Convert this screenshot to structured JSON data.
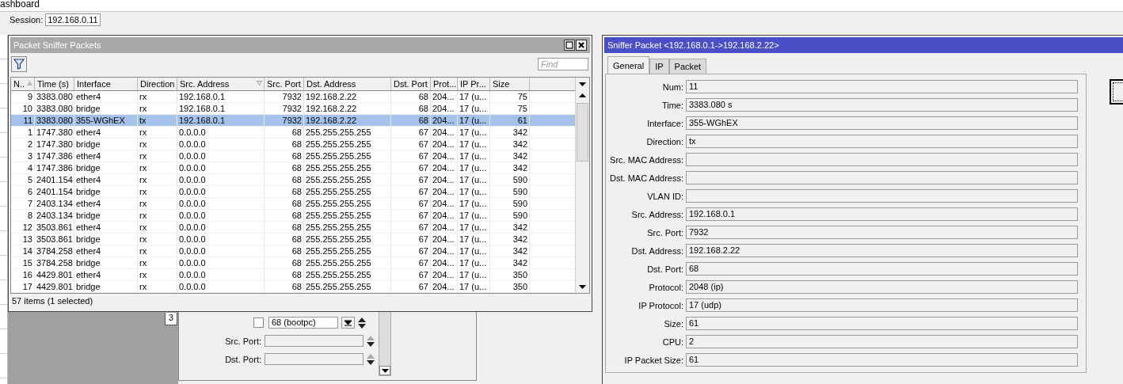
{
  "app_title": "ashboard",
  "session": {
    "label": "Session:",
    "value": "192.168.0.11"
  },
  "packets_window": {
    "title": "Packet Sniffer Packets",
    "find_placeholder": "Find",
    "columns": [
      {
        "label": "N..",
        "sort_asc": true,
        "sort_desc": false
      },
      {
        "label": "Time (s)",
        "sort_asc": false,
        "sort_desc": false
      },
      {
        "label": "Interface",
        "sort_asc": false,
        "sort_desc": false
      },
      {
        "label": "Direction",
        "sort_asc": false,
        "sort_desc": false
      },
      {
        "label": "Src. Address",
        "sort_asc": false,
        "sort_desc": true
      },
      {
        "label": "Src. Port",
        "sort_asc": false,
        "sort_desc": false
      },
      {
        "label": "Dst. Address",
        "sort_asc": false,
        "sort_desc": false
      },
      {
        "label": "Dst. Port",
        "sort_asc": false,
        "sort_desc": false
      },
      {
        "label": "Prot...",
        "sort_asc": false,
        "sort_desc": false
      },
      {
        "label": "IP Pr...",
        "sort_asc": false,
        "sort_desc": false
      },
      {
        "label": "Size",
        "sort_asc": false,
        "sort_desc": false
      }
    ],
    "rows": [
      {
        "selected": false,
        "cells": [
          "9",
          "3383.080",
          "ether4",
          "rx",
          "192.168.0.1",
          "7932",
          "192.168.2.22",
          "68",
          "204...",
          "17 (u...",
          "75"
        ]
      },
      {
        "selected": false,
        "cells": [
          "10",
          "3383.080",
          "bridge",
          "rx",
          "192.168.0.1",
          "7932",
          "192.168.2.22",
          "68",
          "204...",
          "17 (u...",
          "75"
        ]
      },
      {
        "selected": true,
        "cells": [
          "11",
          "3383.080",
          "355-WGhEX",
          "tx",
          "192.168.0.1",
          "7932",
          "192.168.2.22",
          "68",
          "204...",
          "17 (u...",
          "61"
        ]
      },
      {
        "selected": false,
        "cells": [
          "1",
          "1747.380",
          "ether4",
          "rx",
          "0.0.0.0",
          "68",
          "255.255.255.255",
          "67",
          "204...",
          "17 (u...",
          "342"
        ]
      },
      {
        "selected": false,
        "cells": [
          "2",
          "1747.380",
          "bridge",
          "rx",
          "0.0.0.0",
          "68",
          "255.255.255.255",
          "67",
          "204...",
          "17 (u...",
          "342"
        ]
      },
      {
        "selected": false,
        "cells": [
          "3",
          "1747.386",
          "ether4",
          "rx",
          "0.0.0.0",
          "68",
          "255.255.255.255",
          "67",
          "204...",
          "17 (u...",
          "342"
        ]
      },
      {
        "selected": false,
        "cells": [
          "4",
          "1747.386",
          "bridge",
          "rx",
          "0.0.0.0",
          "68",
          "255.255.255.255",
          "67",
          "204...",
          "17 (u...",
          "342"
        ]
      },
      {
        "selected": false,
        "cells": [
          "5",
          "2401.154",
          "ether4",
          "rx",
          "0.0.0.0",
          "68",
          "255.255.255.255",
          "67",
          "204...",
          "17 (u...",
          "590"
        ]
      },
      {
        "selected": false,
        "cells": [
          "6",
          "2401.154",
          "bridge",
          "rx",
          "0.0.0.0",
          "68",
          "255.255.255.255",
          "67",
          "204...",
          "17 (u...",
          "590"
        ]
      },
      {
        "selected": false,
        "cells": [
          "7",
          "2403.134",
          "ether4",
          "rx",
          "0.0.0.0",
          "68",
          "255.255.255.255",
          "67",
          "204...",
          "17 (u...",
          "590"
        ]
      },
      {
        "selected": false,
        "cells": [
          "8",
          "2403.134",
          "bridge",
          "rx",
          "0.0.0.0",
          "68",
          "255.255.255.255",
          "67",
          "204...",
          "17 (u...",
          "590"
        ]
      },
      {
        "selected": false,
        "cells": [
          "12",
          "3503.861",
          "ether4",
          "rx",
          "0.0.0.0",
          "68",
          "255.255.255.255",
          "67",
          "204...",
          "17 (u...",
          "342"
        ]
      },
      {
        "selected": false,
        "cells": [
          "13",
          "3503.861",
          "bridge",
          "rx",
          "0.0.0.0",
          "68",
          "255.255.255.255",
          "67",
          "204...",
          "17 (u...",
          "342"
        ]
      },
      {
        "selected": false,
        "cells": [
          "14",
          "3784.258",
          "ether4",
          "rx",
          "0.0.0.0",
          "68",
          "255.255.255.255",
          "67",
          "204...",
          "17 (u...",
          "342"
        ]
      },
      {
        "selected": false,
        "cells": [
          "15",
          "3784.258",
          "bridge",
          "rx",
          "0.0.0.0",
          "68",
          "255.255.255.255",
          "67",
          "204...",
          "17 (u...",
          "342"
        ]
      },
      {
        "selected": false,
        "cells": [
          "16",
          "4429.801",
          "ether4",
          "rx",
          "0.0.0.0",
          "68",
          "255.255.255.255",
          "67",
          "204...",
          "17 (u...",
          "350"
        ]
      },
      {
        "selected": false,
        "cells": [
          "17",
          "4429.801",
          "bridge",
          "rx",
          "0.0.0.0",
          "68",
          "255.255.255.255",
          "67",
          "204...",
          "17 (u...",
          "350"
        ]
      }
    ],
    "status": "57 items (1 selected)"
  },
  "filter_window": {
    "tab": "3",
    "port_checked": false,
    "port_value": "68 (bootpc)",
    "fields": [
      {
        "label": "Src. Port:"
      },
      {
        "label": "Dst. Port:"
      }
    ]
  },
  "packet_window": {
    "title": "Sniffer Packet <192.168.0.1->192.168.2.22>",
    "tabs": [
      {
        "label": "General",
        "selected": true
      },
      {
        "label": "IP",
        "selected": false
      },
      {
        "label": "Packet",
        "selected": false
      }
    ],
    "fields": [
      {
        "label": "Num:",
        "value": "11"
      },
      {
        "label": "Time:",
        "value": "3383.080 s"
      },
      {
        "label": "Interface:",
        "value": "355-WGhEX"
      },
      {
        "label": "Direction:",
        "value": "tx"
      },
      {
        "label": "Src. MAC Address:"
      },
      {
        "label": "Dst. MAC Address:"
      },
      {
        "label": "VLAN ID:"
      },
      {
        "label": "Src. Address:",
        "value": "192.168.0.1"
      },
      {
        "label": "Src. Port:",
        "value": "7932"
      },
      {
        "label": "Dst. Address:",
        "value": "192.168.2.22"
      },
      {
        "label": "Dst. Port:",
        "value": "68"
      },
      {
        "label": "Protocol:",
        "value": "2048 (ip)"
      },
      {
        "label": "IP Protocol:",
        "value": "17 (udp)"
      },
      {
        "label": "Size:",
        "value": "61"
      },
      {
        "label": "CPU:",
        "value": "2"
      },
      {
        "label": "IP Packet Size:",
        "value": "61"
      }
    ]
  }
}
